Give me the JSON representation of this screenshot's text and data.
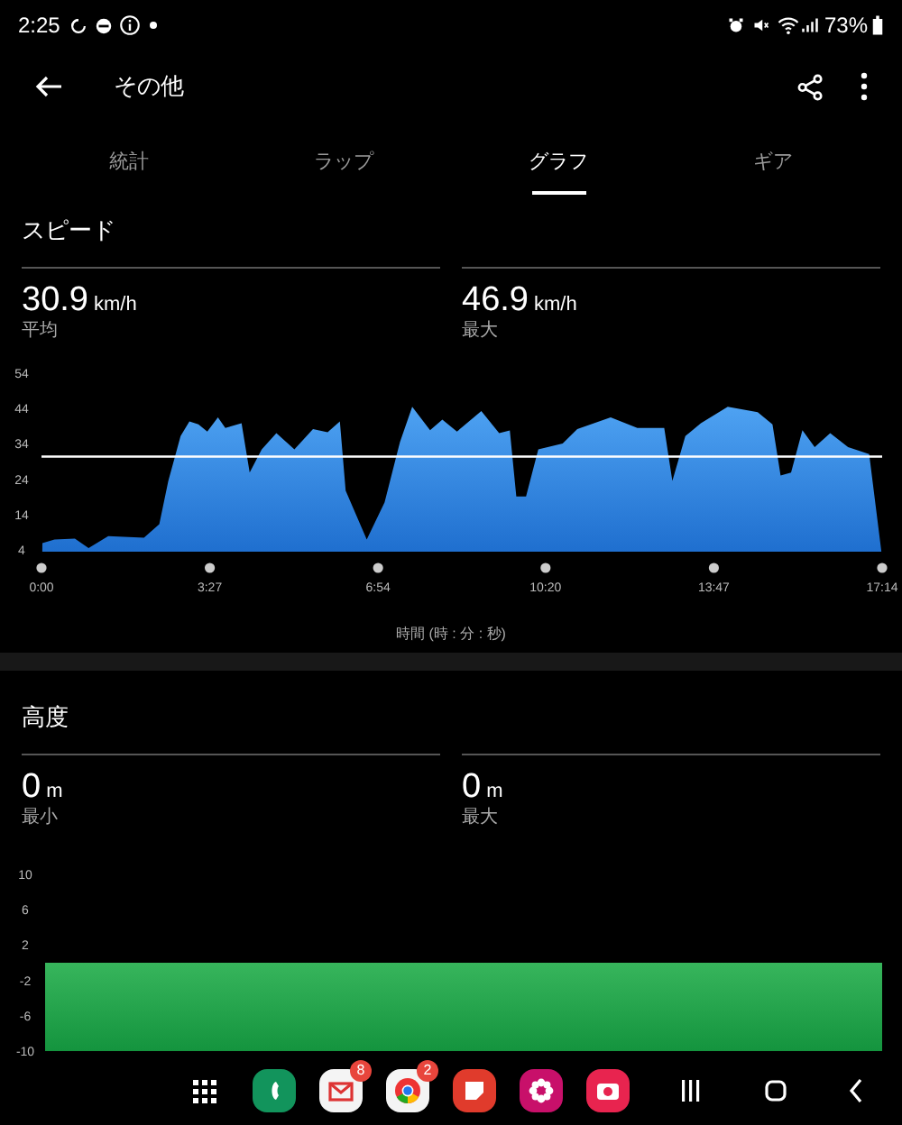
{
  "status_bar": {
    "time": "2:25",
    "battery": "73%"
  },
  "app_bar": {
    "title": "その他"
  },
  "tabs": [
    {
      "label": "統計",
      "selected": false
    },
    {
      "label": "ラップ",
      "selected": false
    },
    {
      "label": "グラフ",
      "selected": true
    },
    {
      "label": "ギア",
      "selected": false
    }
  ],
  "speed": {
    "title": "スピード",
    "stats": [
      {
        "value": "30.9",
        "unit": "km/h",
        "label": "平均"
      },
      {
        "value": "46.9",
        "unit": "km/h",
        "label": "最大"
      }
    ],
    "chart_data": {
      "type": "area",
      "xlabel": "時間 (時 : 分 : 秒)",
      "x": [
        1,
        16,
        41,
        58,
        82,
        126,
        145,
        156,
        171,
        182,
        193,
        204,
        217,
        226,
        246,
        256,
        271,
        289,
        311,
        334,
        352,
        367,
        374,
        400,
        422,
        441,
        456,
        478,
        493,
        511,
        541,
        563,
        576,
        584,
        596,
        611,
        641,
        659,
        700,
        733,
        766,
        776,
        792,
        811,
        844,
        881,
        899,
        909,
        922,
        936,
        951,
        970,
        992,
        1018,
        1033
      ],
      "values": [
        6.4,
        7.4,
        7.7,
        5,
        8.4,
        8,
        11.8,
        24,
        36.7,
        40.9,
        40,
        38,
        42,
        39,
        40.4,
        26.4,
        33,
        37.5,
        33,
        38.7,
        37.8,
        40.9,
        21.3,
        7.4,
        18,
        35,
        45,
        38.4,
        41.4,
        38,
        43.8,
        37.5,
        38.3,
        19.6,
        19.6,
        33,
        34.6,
        38.7,
        42,
        39,
        39,
        24,
        36.7,
        40.4,
        45,
        43.5,
        40,
        25.6,
        26.4,
        38.4,
        33.6,
        37.5,
        33.6,
        31.6,
        4.3
      ],
      "xlim": [
        0,
        1034
      ],
      "ylim": [
        4,
        54
      ],
      "xticks": [
        {
          "value": 0,
          "label": "0:00"
        },
        {
          "value": 207,
          "label": "3:27"
        },
        {
          "value": 414,
          "label": "6:54"
        },
        {
          "value": 620,
          "label": "10:20"
        },
        {
          "value": 827,
          "label": "13:47"
        },
        {
          "value": 1034,
          "label": "17:14"
        }
      ],
      "yticks": [
        54,
        44,
        34,
        24,
        14,
        4
      ],
      "ref_lines": [
        {
          "axis": "y",
          "value": 30.9
        }
      ]
    }
  },
  "altitude": {
    "title": "高度",
    "stats": [
      {
        "value": "0",
        "unit": "m",
        "label": "最小"
      },
      {
        "value": "0",
        "unit": "m",
        "label": "最大"
      }
    ],
    "graph": {
      "axis_labels": [
        "10",
        "6",
        "2",
        "-2",
        "-6",
        "-10"
      ]
    }
  },
  "nav_bar": {
    "apps": [
      {
        "kind": "phone"
      },
      {
        "kind": "mail",
        "badge": "8"
      },
      {
        "kind": "browser",
        "badge": "2"
      },
      {
        "kind": "notes"
      },
      {
        "kind": "flower"
      },
      {
        "kind": "camera"
      }
    ]
  }
}
